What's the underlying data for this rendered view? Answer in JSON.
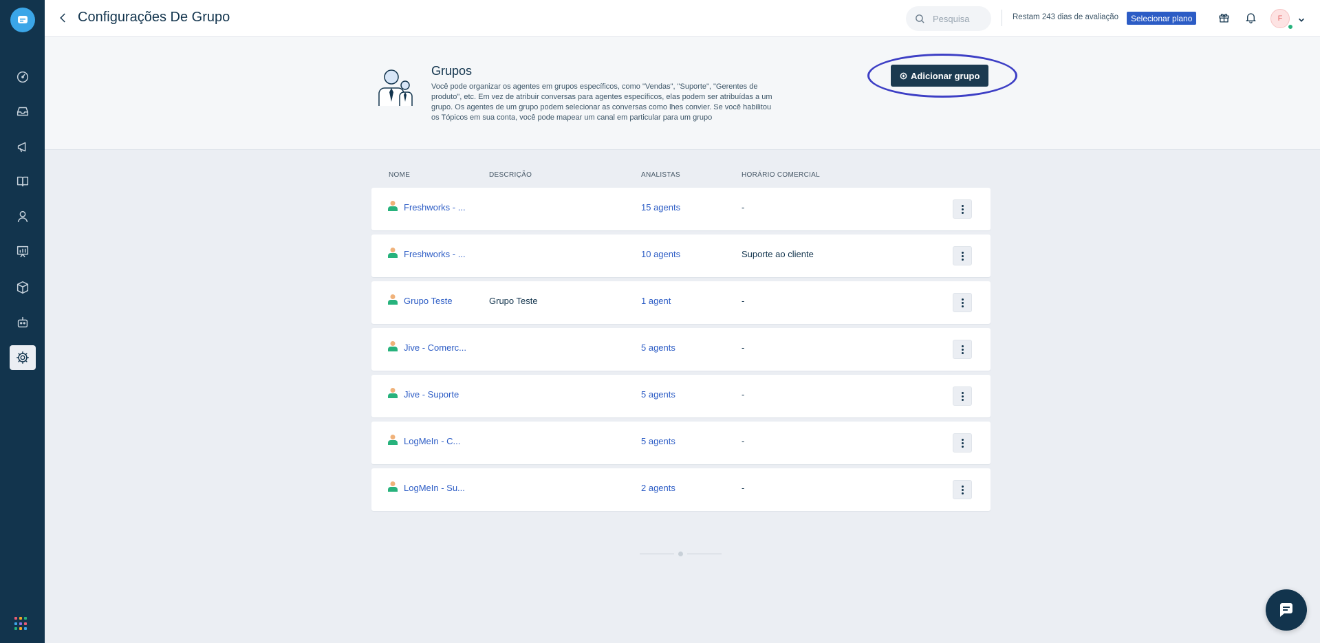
{
  "header": {
    "title": "Configurações De Grupo",
    "search_placeholder": "Pesquisa",
    "trial_text": "Restam 243 dias de avaliação",
    "plan_button": "Selecionar plano",
    "avatar_initial": "F"
  },
  "sidebar": {
    "items": [
      {
        "icon": "dashboard-icon"
      },
      {
        "icon": "inbox-icon"
      },
      {
        "icon": "campaigns-icon"
      },
      {
        "icon": "solutions-book-icon"
      },
      {
        "icon": "contacts-icon"
      },
      {
        "icon": "reports-icon"
      },
      {
        "icon": "marketplace-box-icon"
      },
      {
        "icon": "bot-icon"
      },
      {
        "icon": "settings-gear-icon",
        "active": true
      }
    ],
    "accent_colors": [
      "#e85d75",
      "#f5a623",
      "#27b27c",
      "#3ba6e8",
      "#8e6fe0",
      "#e85d75",
      "#27b27c",
      "#f5a623",
      "#3ba6e8"
    ]
  },
  "info": {
    "title": "Grupos",
    "description": "Você pode organizar os agentes em grupos específicos, como \"Vendas\", \"Suporte\", \"Gerentes de produto\", etc. Em vez de atribuir conversas para agentes específicos, elas podem ser atribuídas a um grupo. Os agentes de um grupo podem selecionar as conversas como lhes convier. Se você habilitou os Tópicos em sua conta, você pode mapear um canal em particular para um grupo",
    "add_button": "Adicionar grupo"
  },
  "table": {
    "columns": {
      "name": "NOME",
      "description": "DESCRIÇÃO",
      "agents": "ANALISTAS",
      "hours": "HORÁRIO COMERCIAL"
    },
    "rows": [
      {
        "name": "Freshworks - ...",
        "description": "",
        "agents": "15 agents",
        "hours": "-"
      },
      {
        "name": "Freshworks - ...",
        "description": "",
        "agents": "10 agents",
        "hours": "Suporte ao cliente"
      },
      {
        "name": "Grupo Teste",
        "description": "Grupo Teste",
        "agents": "1 agent",
        "hours": "-"
      },
      {
        "name": "Jive - Comerc...",
        "description": "",
        "agents": "5 agents",
        "hours": "-"
      },
      {
        "name": "Jive - Suporte",
        "description": "",
        "agents": "5 agents",
        "hours": "-"
      },
      {
        "name": "LogMeIn - C...",
        "description": "",
        "agents": "5 agents",
        "hours": "-"
      },
      {
        "name": "LogMeIn - Su...",
        "description": "",
        "agents": "2 agents",
        "hours": "-"
      }
    ]
  },
  "colors": {
    "sidebar": "#12344d",
    "link": "#2c5cc5",
    "plan_button": "#2c5cc5",
    "add_button": "#1b3a50",
    "highlight_ring": "#3d3fc5",
    "user_icon_body": "#27b27c",
    "user_icon_head": "#f0b27a"
  }
}
